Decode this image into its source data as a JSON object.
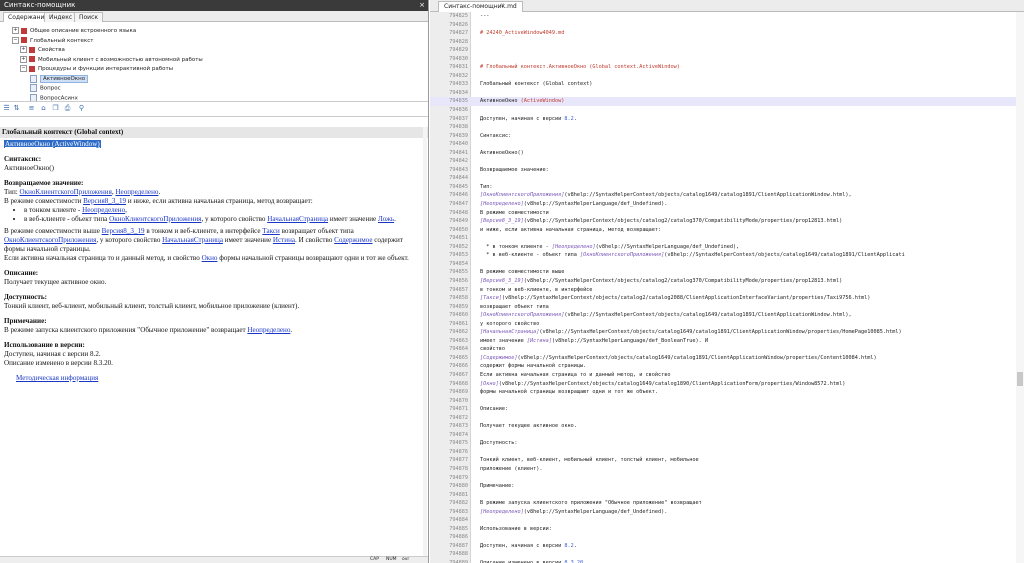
{
  "left_panel": {
    "title": "Синтакс-помощник",
    "close_glyph": "×",
    "tabs": [
      "Содержание",
      "Индекс",
      "Поиск"
    ],
    "tree": [
      {
        "label": "Общее описание встроенного языка",
        "level": 1,
        "expander": "+"
      },
      {
        "label": "Глобальный контекст",
        "level": 1,
        "expander": "−"
      },
      {
        "label": "Свойства",
        "level": 2,
        "expander": "+"
      },
      {
        "label": "Мобильный клиент с возможностью автономной работы",
        "level": 2,
        "expander": "+"
      },
      {
        "label": "Процедуры и функции интерактивной работы",
        "level": 2,
        "expander": "−"
      },
      {
        "label": "АктивноеОкно",
        "level": 3,
        "selected": true
      },
      {
        "label": "Вопрос",
        "level": 3
      },
      {
        "label": "ВопросАсинх",
        "level": 3
      },
      {
        "label": "ВыполнитьОбработкуОповещения",
        "level": 3
      }
    ],
    "toolbar_icons": [
      "list-icon",
      "sort-icon",
      "list-view-icon",
      "home-icon",
      "copy-icon",
      "print-icon",
      "search-icon"
    ],
    "doc": {
      "header": "Глобальный контекст (Global context)",
      "title": "АктивноеОкно (ActiveWindow)",
      "syntax_h": "Синтаксис:",
      "syntax": "АктивноеОкно()",
      "return_h": "Возвращаемое значение:",
      "type_prefix": "Тип: ",
      "type_link1": "ОкноКлиентскогоПриложения",
      "type_sep": ", ",
      "type_link2": "Неопределено",
      "type_end": ".",
      "compat1_a": "В режиме совместимости ",
      "compat1_link": "Версия8_3_19",
      "compat1_b": " и ниже, если активна начальная страница, метод возвращает:",
      "li1_a": "в тонком клиенте - ",
      "li1_link": "Неопределено",
      "li1_b": ",",
      "li2_a": "в веб-клиенте - объект типа ",
      "li2_link": "ОкноКлиентскогоПриложения",
      "li2_b": ", у которого свойство ",
      "li2_link2": "НачальнаяСтраница",
      "li2_c": " имеет значение ",
      "li2_link3": "Ложь",
      "li2_d": ".",
      "compat2_a": "В режиме совместимости выше ",
      "compat2_link": "Версия8_3_19",
      "compat2_b": " в тонком и веб-клиенте, в интерфейсе ",
      "compat2_link2": "Такси",
      "compat2_c": " возвращает объект типа ",
      "compat2_link3": "ОкноКлиентскогоПриложения",
      "compat2_d": ", у которого свойство ",
      "compat2_link4": "НачальнаяСтраница",
      "compat2_e": " имеет значение ",
      "compat2_link5": "Истина",
      "compat2_f": ". И свойство ",
      "compat2_link6": "Содержимое",
      "compat2_g": " содержит формы начальной страницы.",
      "compat3_a": "Если активна начальная страница то и данный метод, и свойство ",
      "compat3_link": "Окно",
      "compat3_b": " формы начальной страницы возвращают одни и тот же объект.",
      "desc_h": "Описание:",
      "desc": "Получает текущее активное окно.",
      "avail_h": "Доступность:",
      "avail": "Тонкий клиент, веб-клиент, мобильный клиент, толстый клиент, мобильное приложение (клиент).",
      "note_h": "Примечание:",
      "note_a": "В режиме запуска клиентского приложения \"Обычное приложение\" возвращает ",
      "note_link": "Неопределено",
      "note_b": ".",
      "usage_h": "Использование в версии:",
      "usage1": "Доступен, начиная с версии 8.2.",
      "usage2": "Описание изменено в версии 8.3.20.",
      "method_link": "Методическая информация"
    },
    "status": [
      "CAP",
      "NUM",
      "ovr"
    ]
  },
  "right_panel": {
    "tab_title": "Синтакс-помощник.md",
    "tab_close": "×",
    "lines": [
      {
        "n": "794825",
        "t": "---",
        "c": ""
      },
      {
        "n": "794826",
        "t": "",
        "c": ""
      },
      {
        "n": "794827",
        "t": "# 24240_ActiveWindow4049.md",
        "c": "h"
      },
      {
        "n": "794828",
        "t": "",
        "c": ""
      },
      {
        "n": "794829",
        "t": "",
        "c": ""
      },
      {
        "n": "794830",
        "t": "",
        "c": ""
      },
      {
        "n": "794831",
        "t": "# Глобальный контекст.АктивноеОкно (Global context.ActiveWindow)",
        "c": "h"
      },
      {
        "n": "794832",
        "t": "",
        "c": ""
      },
      {
        "n": "794833",
        "t": "Глобальный контекст (Global context)",
        "c": ""
      },
      {
        "n": "794834",
        "t": "",
        "c": ""
      },
      {
        "n": "794835",
        "t": "АктивноеОкно (ActiveWindow)",
        "c": "sel"
      },
      {
        "n": "794836",
        "t": "",
        "c": ""
      },
      {
        "n": "794837",
        "t": "Доступен, начиная с версии 8.2.",
        "c": "ver"
      },
      {
        "n": "794838",
        "t": "",
        "c": ""
      },
      {
        "n": "794839",
        "t": "Синтаксис:",
        "c": ""
      },
      {
        "n": "794840",
        "t": "",
        "c": ""
      },
      {
        "n": "794841",
        "t": "АктивноеОкно()",
        "c": ""
      },
      {
        "n": "794842",
        "t": "",
        "c": ""
      },
      {
        "n": "794843",
        "t": "Возвращаемое значение:",
        "c": ""
      },
      {
        "n": "794844",
        "t": "",
        "c": ""
      },
      {
        "n": "794845",
        "t": "Тип:",
        "c": ""
      },
      {
        "n": "794846",
        "t": "[ОкноКлиентскогоПриложения](v8help://SyntaxHelperContext/objects/catalog1649/catalog1891/ClientApplicationWindow.html),",
        "c": "lnk"
      },
      {
        "n": "794847",
        "t": "[Неопределено](v8help://SyntaxHelperLanguage/def_Undefined).",
        "c": "lnk"
      },
      {
        "n": "794848",
        "t": "В режиме совместимости",
        "c": ""
      },
      {
        "n": "794849",
        "t": "[Версия8_3_19](v8help://SyntaxHelperContext/objects/catalog2/catalog370/CompatibilityMode/properties/prop12813.html)",
        "c": "lnk"
      },
      {
        "n": "794850",
        "t": "и ниже, если активна начальная страница, метод возвращает:",
        "c": ""
      },
      {
        "n": "794851",
        "t": "",
        "c": ""
      },
      {
        "n": "794852",
        "t": "  * в тонком клиенте - [Неопределено](v8help://SyntaxHelperLanguage/def_Undefined),",
        "c": "lnk"
      },
      {
        "n": "794853",
        "t": "  * в веб-клиенте - объект типа [ОкноКлиентскогоПриложения](v8help://SyntaxHelperContext/objects/catalog1649/catalog1891/ClientApplicati",
        "c": "lnk"
      },
      {
        "n": "794854",
        "t": "",
        "c": ""
      },
      {
        "n": "794855",
        "t": "В режиме совместимости выше",
        "c": ""
      },
      {
        "n": "794856",
        "t": "[Версия8_3_19](v8help://SyntaxHelperContext/objects/catalog2/catalog370/CompatibilityMode/properties/prop12813.html)",
        "c": "lnk"
      },
      {
        "n": "794857",
        "t": "в тонком и веб-клиенте, в интерфейсе",
        "c": ""
      },
      {
        "n": "794858",
        "t": "[Такси](v8help://SyntaxHelperContext/objects/catalog2/catalog2088/ClientApplicationInterfaceVariant/properties/Taxi9756.html)",
        "c": "lnk"
      },
      {
        "n": "794859",
        "t": "возвращает объект типа",
        "c": ""
      },
      {
        "n": "794860",
        "t": "[ОкноКлиентскогоПриложения](v8help://SyntaxHelperContext/objects/catalog1649/catalog1891/ClientApplicationWindow.html),",
        "c": "lnk"
      },
      {
        "n": "794861",
        "t": "у которого свойство",
        "c": ""
      },
      {
        "n": "794862",
        "t": "[НачальнаяСтраница](v8help://SyntaxHelperContext/objects/catalog1649/catalog1891/ClientApplicationWindow/properties/HomePage10085.html)",
        "c": "lnk"
      },
      {
        "n": "794863",
        "t": "имеет значение [Истина](v8help://SyntaxHelperLanguage/def_BooleanTrue). И",
        "c": "lnk"
      },
      {
        "n": "794864",
        "t": "свойство",
        "c": ""
      },
      {
        "n": "794865",
        "t": "[Содержимое](v8help://SyntaxHelperContext/objects/catalog1649/catalog1891/ClientApplicationWindow/properties/Content10084.html)",
        "c": "lnk"
      },
      {
        "n": "794866",
        "t": "содержит формы начальной страницы.",
        "c": ""
      },
      {
        "n": "794867",
        "t": "Если активна начальная страница то и данный метод, и свойство",
        "c": ""
      },
      {
        "n": "794868",
        "t": "[Окно](v8help://SyntaxHelperContext/objects/catalog1649/catalog1890/ClientApplicationForm/properties/Window8572.html)",
        "c": "lnk"
      },
      {
        "n": "794869",
        "t": "формы начальной страницы возвращают одни и тот же объект.",
        "c": ""
      },
      {
        "n": "794870",
        "t": "",
        "c": ""
      },
      {
        "n": "794871",
        "t": "Описание:",
        "c": ""
      },
      {
        "n": "794872",
        "t": "",
        "c": ""
      },
      {
        "n": "794873",
        "t": "Получает текущее активное окно.",
        "c": ""
      },
      {
        "n": "794874",
        "t": "",
        "c": ""
      },
      {
        "n": "794875",
        "t": "Доступность:",
        "c": ""
      },
      {
        "n": "794876",
        "t": "",
        "c": ""
      },
      {
        "n": "794877",
        "t": "Тонкий клиент, веб-клиент, мобильный клиент, толстый клиент, мобильное",
        "c": ""
      },
      {
        "n": "794878",
        "t": "приложение (клиент).",
        "c": ""
      },
      {
        "n": "794879",
        "t": "",
        "c": ""
      },
      {
        "n": "794880",
        "t": "Примечание:",
        "c": ""
      },
      {
        "n": "794881",
        "t": "",
        "c": ""
      },
      {
        "n": "794882",
        "t": "В режиме запуска клиентского приложения \"Обычное приложение\" возвращает",
        "c": ""
      },
      {
        "n": "794883",
        "t": "[Неопределено](v8help://SyntaxHelperLanguage/def_Undefined).",
        "c": "lnk"
      },
      {
        "n": "794884",
        "t": "",
        "c": ""
      },
      {
        "n": "794885",
        "t": "Использование в версии:",
        "c": ""
      },
      {
        "n": "794886",
        "t": "",
        "c": ""
      },
      {
        "n": "794887",
        "t": "Доступен, начиная с версии 8.2.",
        "c": "ver"
      },
      {
        "n": "794888",
        "t": "",
        "c": ""
      },
      {
        "n": "794889",
        "t": "Описание изменено в версии 8.3.20.",
        "c": "ver"
      },
      {
        "n": "794890",
        "t": "",
        "c": ""
      },
      {
        "n": "794891",
        "t": "* * *",
        "c": ""
      }
    ]
  }
}
